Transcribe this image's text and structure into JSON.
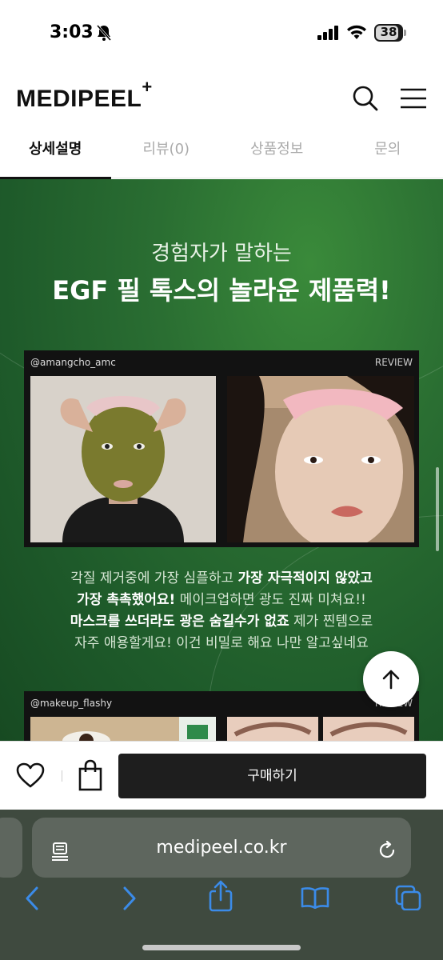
{
  "status_bar": {
    "time": "3:03",
    "battery": "38"
  },
  "header": {
    "logo": "MEDIPEEL",
    "logo_sup": "+"
  },
  "tabs": [
    {
      "label": "상세설명",
      "active": true
    },
    {
      "label": "리뷰(0)",
      "active": false
    },
    {
      "label": "상품정보",
      "active": false
    },
    {
      "label": "문의",
      "active": false
    }
  ],
  "content": {
    "heading_line1": "경험자가 말하는",
    "heading_line2": "EGF 필 톡스의 놀라운 제품력!",
    "review1": {
      "handle": "@amangcho_amc",
      "tag": "REVIEW"
    },
    "caption": {
      "l1_a": "각질 제거중에 가장 심플하고 ",
      "l1_b": "가장 자극적이지 않았고",
      "l2_a": "가장 촉촉했어요!",
      "l2_b": " 메이크업하면 광도 진짜 미쳐요!!",
      "l3_a": "마스크를 쓰더라도 광은 숨길수가 없죠",
      "l3_b": " 제가 찐템으로",
      "l4": "자주 애용할게요! 이건 비밀로 해요 나만 알고싶네요"
    },
    "review2": {
      "handle": "@makeup_flashy",
      "tag": "REVIEW"
    }
  },
  "buy_bar": {
    "buy_label": "구매하기"
  },
  "browser": {
    "url": "medipeel.co.kr"
  },
  "colors": {
    "accent_green": "#2a6e32",
    "buy_button": "#1e1e1e"
  }
}
